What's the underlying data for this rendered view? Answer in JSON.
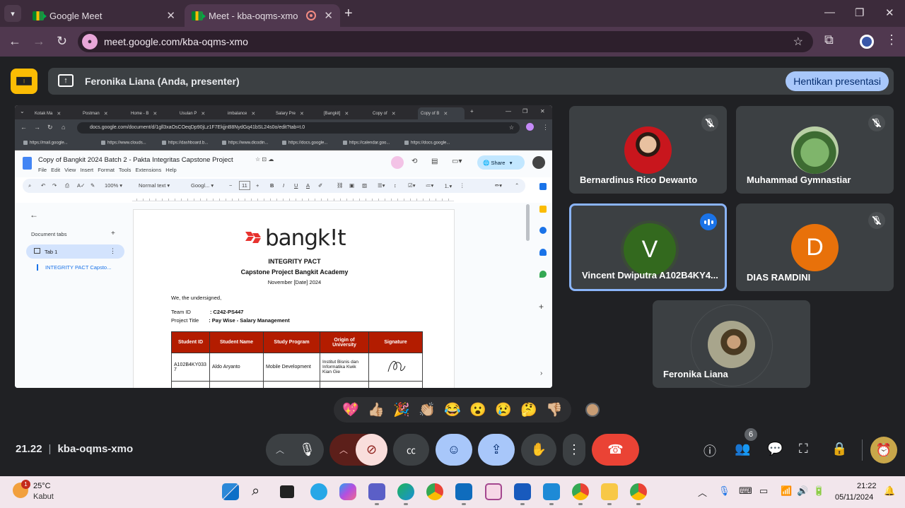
{
  "browser": {
    "tabs": [
      {
        "title": "Google Meet",
        "active": false
      },
      {
        "title": "Meet - kba-oqms-xmo",
        "active": true
      }
    ],
    "url": "meet.google.com/kba-oqms-xmo"
  },
  "presenter_bar": {
    "text": "Feronika Liana (Anda, presenter)",
    "stop_button": "Hentikan presentasi"
  },
  "shared_screen": {
    "inner_tabs": [
      "Kotak Ma",
      "Postman",
      "Home - B",
      "Usulan P",
      "imbalance",
      "Salary Pre",
      "[Bangkit]",
      "Copy of",
      "Copy of B"
    ],
    "inner_url": "docs.google.com/document/d/1gll3xaOsCOeqDp90jLz1F7EkjjnB8NydGq41bSL24s0o/edit?tab=t.0",
    "bookmarks": [
      "https://mail.google...",
      "https://www.clouds...",
      "https://dashboard.b...",
      "https://www.dicodin...",
      "https://docs.google...",
      "https://calendar.goo...",
      "https://docs.google..."
    ],
    "doc_title": "Copy of Bangkit 2024 Batch 2 - Pakta Integritas Capstone Project",
    "doc_menu": "File  Edit  View  Insert  Format  Tools  Extensions  Help",
    "share_label": "Share",
    "zoom": "100%",
    "style": "Normal text",
    "font": "Googl...",
    "font_size": "11",
    "outline_title": "Document tabs",
    "outline_tab": "Tab 1",
    "outline_heading": "INTEGRITY PACT Capsto...",
    "logo_text": "bangk!t",
    "pact_title": "INTEGRITY PACT",
    "pact_subtitle": "Capstone Project Bangkit Academy",
    "pact_date": "November [Date] 2024",
    "undersigned": "We, the undersigned,",
    "team_id_label": "Team ID",
    "team_id_value": ": C242-PS447",
    "project_title_label": "Project Title",
    "project_title_value": ": Pay Wise - Salary Management",
    "table_headers": [
      "Student ID",
      "Student Name",
      "Study Program",
      "Origin of University",
      "Signature"
    ],
    "table_rows": [
      [
        "A102B4KY0337",
        "Aldo Aryanto",
        "Mobile Development",
        "Institut Bisnis dan Informatika Kwik Kian Gie",
        ""
      ]
    ]
  },
  "participants": [
    {
      "name": "Bernardinus Rico Dewanto",
      "muted": true,
      "avatar": "photo"
    },
    {
      "name": "Muhammad Gymnastiar",
      "muted": true,
      "avatar": "photo"
    },
    {
      "name": "Vincent Dwiputra A102B4KY4...",
      "speaking": true,
      "avatar": "letter",
      "initial": "V",
      "color": "#33691e"
    },
    {
      "name": "DIAS RAMDINI",
      "muted": true,
      "avatar": "letter",
      "initial": "D",
      "color": "#e8710a"
    },
    {
      "name": "Feronika Liana",
      "avatar": "photo"
    }
  ],
  "reactions": [
    "💖",
    "👍🏼",
    "🎉",
    "👏🏼",
    "😂",
    "😮",
    "😢",
    "🤔",
    "👎🏼"
  ],
  "meeting": {
    "time": "21.22",
    "code": "kba-oqms-xmo",
    "participant_count": "6"
  },
  "taskbar": {
    "temperature": "25°C",
    "weather": "Kabut",
    "weather_badge": "1",
    "time": "21:22",
    "date": "05/11/2024"
  },
  "colors": {
    "accent": "#a8c7fa",
    "end_call": "#ea4335",
    "tile_bg": "#3c4043",
    "speaking_border": "#8ab4f8"
  }
}
